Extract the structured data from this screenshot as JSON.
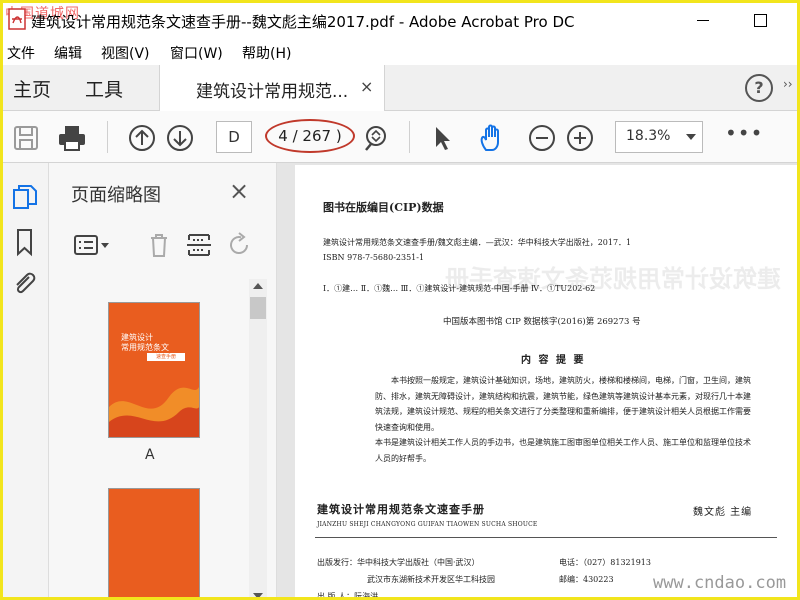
{
  "window": {
    "title": "建筑设计常用规范条文速查手册--魏文彪主编2017.pdf - Adobe Acrobat Pro DC",
    "watermark": "中国道城网"
  },
  "menu": [
    "文件",
    "编辑",
    "视图(V)",
    "窗口(W)",
    "帮助(H)"
  ],
  "tabs": {
    "home": "主页",
    "tools": "工具",
    "document": "建筑设计常用规范...",
    "close": "×"
  },
  "toolbar": {
    "page_input": "D",
    "page_count": "4 / 267 )",
    "zoom": "18.3%",
    "more": "•••",
    "icons": [
      "save-icon",
      "print-icon",
      "page-up-icon",
      "page-down-icon",
      "search-icon",
      "select-arrow-icon",
      "hand-icon",
      "zoom-out-icon",
      "zoom-in-icon"
    ]
  },
  "help": "?",
  "right_more": "››",
  "side_panel": {
    "title": "页面缩略图",
    "close": "×",
    "thumbnails": [
      {
        "label": "A",
        "cover_title": "建筑设计\n常用规范条文",
        "cover_badge": "速查手册"
      },
      {
        "label": ""
      }
    ]
  },
  "document": {
    "cip_title": "图书在版编目(CIP)数据",
    "cip_line1": "建筑设计常用规范条文速查手册/魏文彪主编．—武汉：华中科技大学出版社，2017．1",
    "cip_isbn": "ISBN 978-7-5680-2351-1",
    "cip_class": "Ⅰ．①建…   Ⅱ．①魏…   Ⅲ．①建筑设计-建筑规范-中国-手册   Ⅳ．①TU202-62",
    "cip_number": "中国版本图书馆 CIP 数据核字(2016)第 269273 号",
    "summary_head": "内 容 提 要",
    "summary": "本书按照一般规定，建筑设计基础知识，场地，建筑防火，楼梯和楼梯间，电梯，门窗，卫生间，建筑防、排水，建筑无障碍设计，建筑结构和抗震，建筑节能，绿色建筑等建筑设计基本元素，对现行几十本建筑法规，建筑设计规范、规程的相关条文进行了分类整理和重新编排，便于建筑设计相关人员根据工作需要快速查询和使用。\n本书是建筑设计相关工作人员的手边书，也是建筑施工图审图单位相关工作人员、施工单位和监理单位技术人员的好帮手。",
    "book_title": "建筑设计常用规范条文速查手册",
    "book_pinyin": "JIANZHU SHEJI CHANGYONG GUIFAN TIAOWEN SUCHA SHOUCE",
    "book_editor": "魏文彪   主编",
    "pub_a": "出版发行：华中科技大学出版社（中国·武汉）",
    "pub_phone": "电话：（027）81321913",
    "pub_b": "武汉市东湖新技术开发区华工科技园",
    "pub_post": "邮编：430223",
    "pub_c": "出 版 人：阮海洪",
    "site_watermark": "www.cndao.com"
  },
  "colors": {
    "frame": "#f2e51d",
    "accent_blue": "#1473e6",
    "highlight_ring": "#c0392b",
    "cover_orange": "#e95d1f"
  }
}
